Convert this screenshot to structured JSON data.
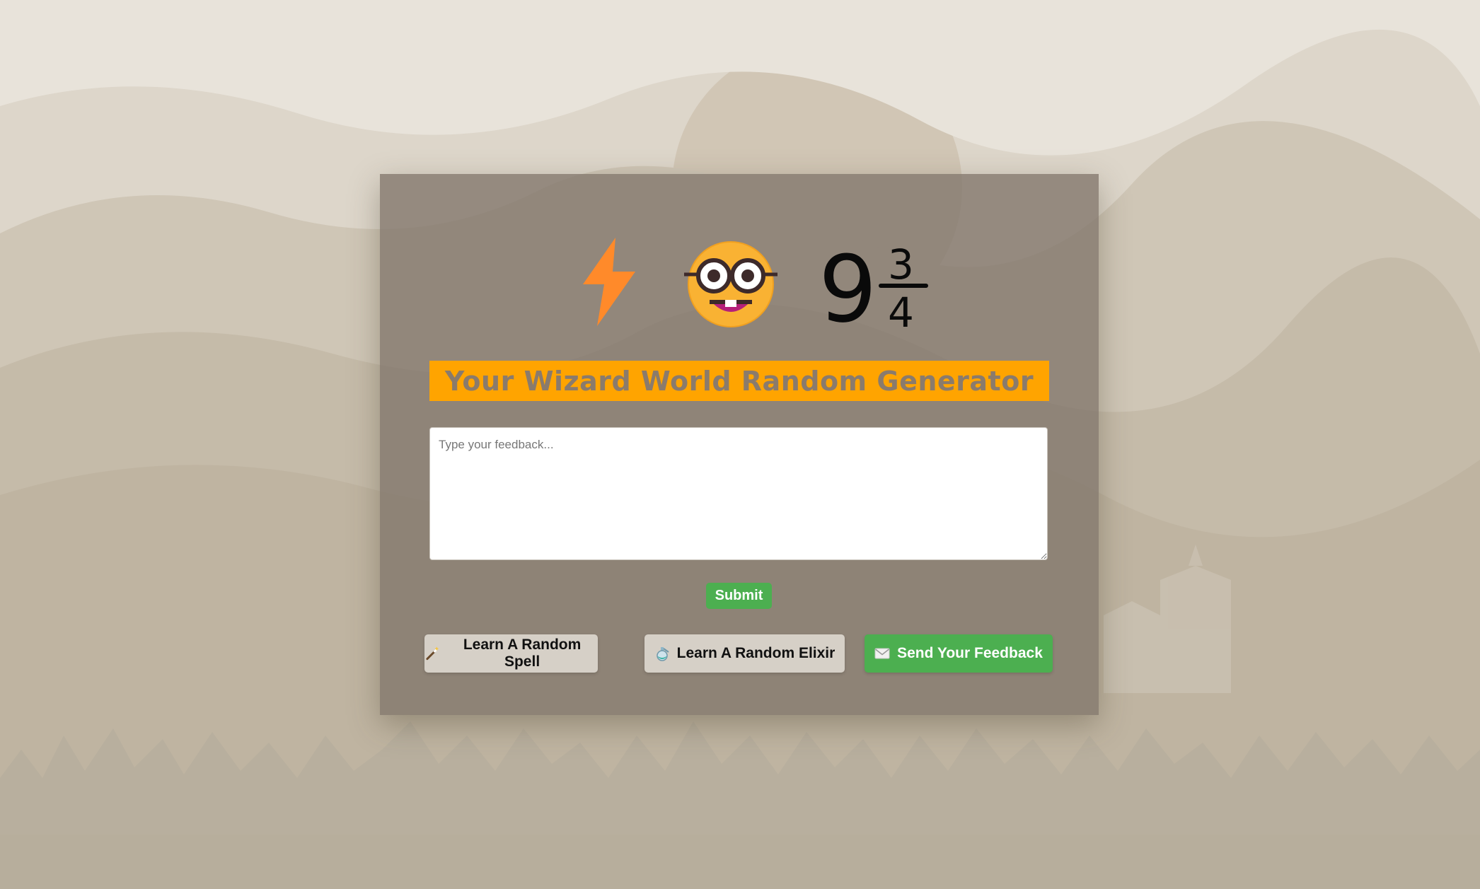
{
  "header": {
    "icons": [
      "lightning-bolt-icon",
      "nerd-face-icon",
      "platform-nine-three-quarters-icon"
    ],
    "platform_whole": "9",
    "platform_numerator": "3",
    "platform_denominator": "4"
  },
  "title": "Your Wizard World Random Generator",
  "feedback": {
    "placeholder": "Type your feedback...",
    "value": ""
  },
  "submit_label": "Submit",
  "actions": {
    "spell_label": "Learn A Random Spell",
    "spell_icon": "magic-wand-icon",
    "elixir_label": "Learn A Random Elixir",
    "elixir_icon": "alembic-icon",
    "feedback_label": "Send Your Feedback",
    "feedback_icon": "envelope-icon"
  },
  "colors": {
    "title_bar": "#ffa400",
    "title_text": "#8a7b6c",
    "panel": "#80756a",
    "green_button": "#4caf50",
    "grey_button": "#d6d0c7",
    "bolt": "#ff8a2a",
    "face": "#f9b233"
  }
}
